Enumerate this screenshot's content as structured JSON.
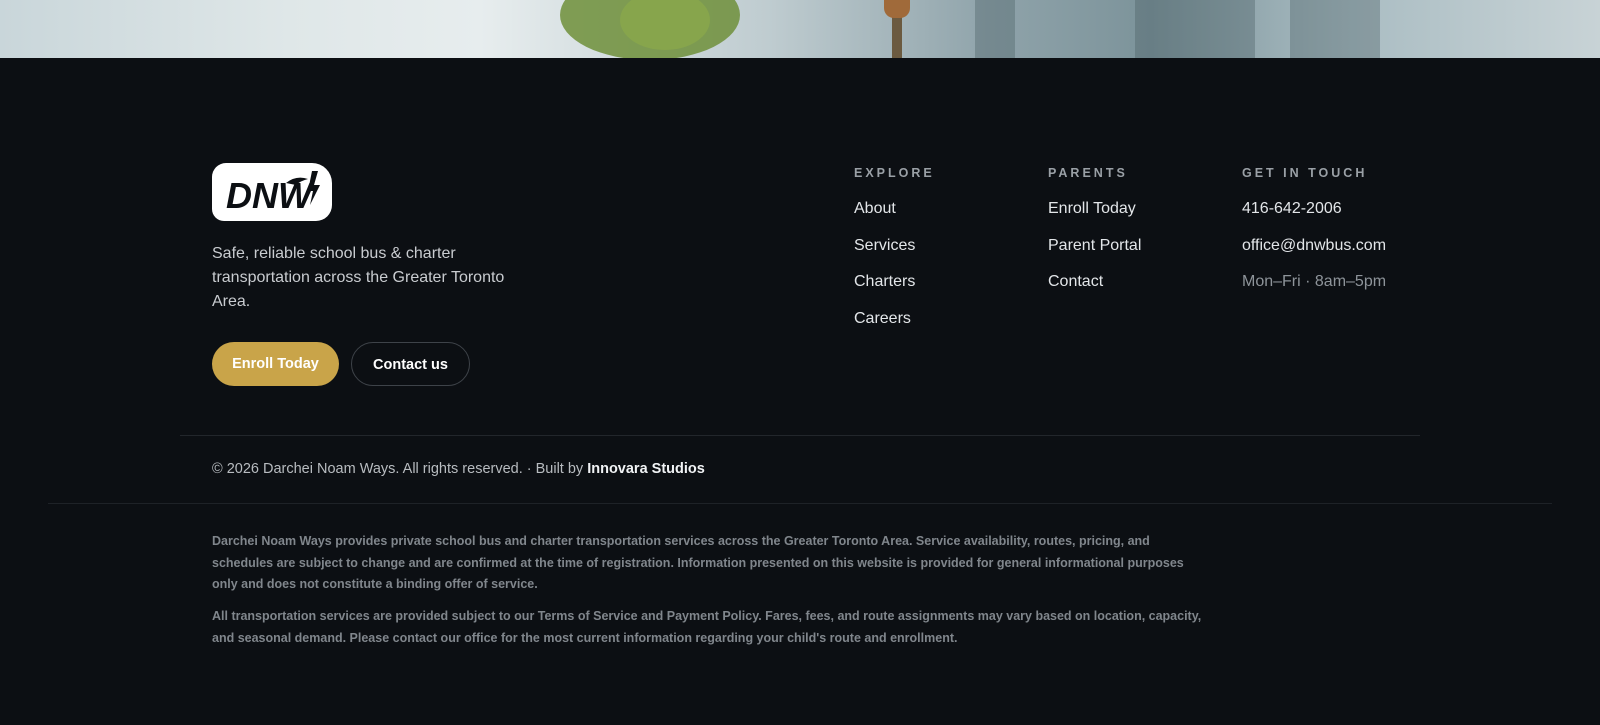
{
  "brand": {
    "logo_text": "DNW",
    "tagline": "Safe, reliable school bus & charter transportation across the Greater Toronto Area."
  },
  "cta": {
    "enroll_label": "Enroll Today",
    "contact_label": "Contact us"
  },
  "columns": [
    {
      "heading": "EXPLORE",
      "items": [
        "About",
        "Services",
        "Charters",
        "Careers"
      ]
    },
    {
      "heading": "PARENTS",
      "items": [
        "Enroll Today",
        "Parent Portal",
        "Contact"
      ]
    },
    {
      "heading": "GET IN TOUCH",
      "items": [
        "416-642-2006",
        "office@dnwbus.com",
        "Mon–Fri · 8am–5pm"
      ]
    }
  ],
  "footer": {
    "copyright": "© 2026 Darchei Noam Ways. All rights reserved. · Built by ",
    "studio": "Innovara Studios"
  },
  "legal": {
    "p1": "Darchei Noam Ways provides private school bus and charter transportation services across the Greater Toronto Area. Service availability, routes, pricing, and schedules are subject to change and are confirmed at the time of registration. Information presented on this website is provided for general informational purposes only and does not constitute a binding offer of service.",
    "p2": "All transportation services are provided subject to our Terms of Service and Payment Policy. Fares, fees, and route assignments may vary based on location, capacity, and seasonal demand. Please contact our office for the most current information regarding your child's route and enrollment."
  },
  "colors": {
    "background": "#0c0f13",
    "accent": "#c9a449"
  }
}
